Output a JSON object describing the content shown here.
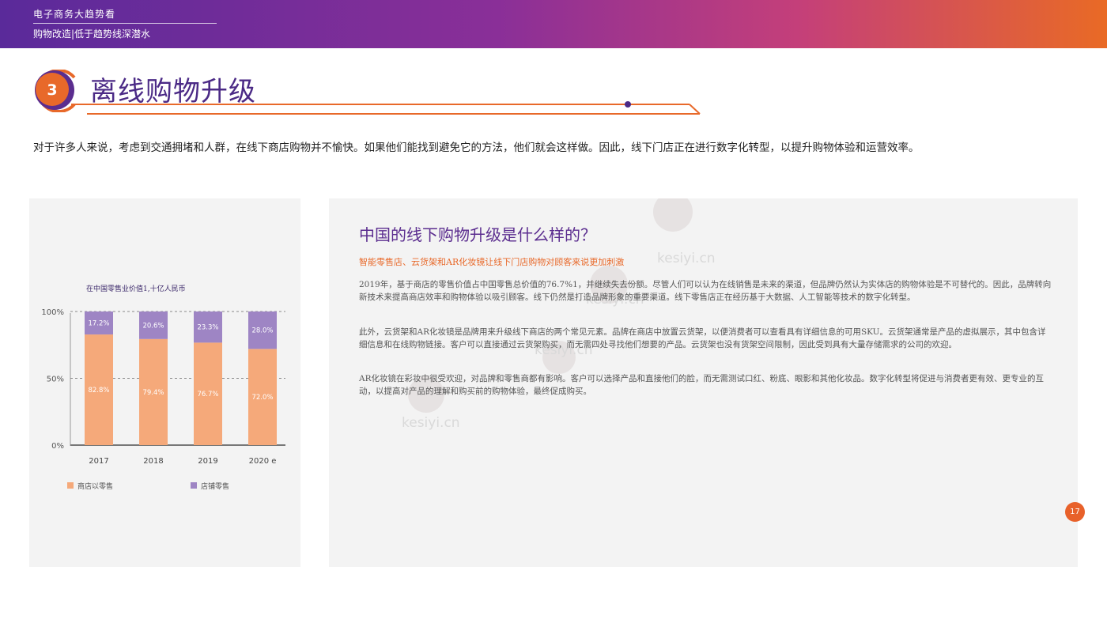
{
  "banner": {
    "title": "电子商务大趋势看",
    "subtitle": "购物改造|低于趋势线深潜水"
  },
  "section": {
    "number": "3",
    "title": "离线购物升级"
  },
  "intro_text": "对于许多人来说，考虑到交通拥堵和人群，在线下商店购物并不愉快。如果他们能找到避免它的方法，他们就会这样做。因此，线下门店正在进行数字化转型，以提升购物体验和运营效率。",
  "panel": {
    "heading": "中国的线下购物升级是什么样的？",
    "subheading": "智能零售店、云货架和AR化妆镜让线下门店购物对顾客来说更加刺激",
    "paragraphs": [
      "2019年，基于商店的零售价值占中国零售总价值的76.7%1，并继续失去份额。尽管人们可以认为在线销售是未来的渠道，但品牌仍然认为实体店的购物体验是不可替代的。因此，品牌转向新技术来提高商店效率和购物体验以吸引顾客。线下仍然是打造品牌形象的重要渠道。线下零售店正在经历基于大数据、人工智能等技术的数字化转型。",
      "此外，云货架和AR化妆镜是品牌用来升级线下商店的两个常见元素。品牌在商店中放置云货架，以便消费者可以查看具有详细信息的可用SKU。云货架通常是产品的虚拟展示，其中包含详细信息和在线购物链接。客户可以直接通过云货架购买，而无需四处寻找他们想要的产品。云货架也没有货架空间限制，因此受到具有大量存储需求的公司的欢迎。",
      "AR化妆镜在彩妆中很受欢迎，对品牌和零售商都有影响。客户可以选择产品和直接他们的脸，而无需测试口红、粉底、眼影和其他化妆品。数字化转型将促进与消费者更有效、更专业的互动，以提高对产品的理解和购买前的购物体验，最终促成购买。"
    ]
  },
  "watermark": "kesiyi.cn",
  "page_number": "17",
  "colors": {
    "brand_purple": "#5b2d8f",
    "brand_orange": "#e8692a",
    "store_series": "#f5a97a",
    "online_series": "#9e85c4"
  },
  "chart_data": {
    "type": "bar",
    "stacked": true,
    "percent": true,
    "title": "在中国零售业价值1,十亿人民币",
    "categories": [
      "2017",
      "2018",
      "2019",
      "2020 e"
    ],
    "series": [
      {
        "name": "商店以零售",
        "values": [
          82.8,
          79.4,
          76.7,
          72.0
        ],
        "labels": [
          "82.8%",
          "79.4%",
          "76.7%",
          "72.0%"
        ],
        "color": "#f5a97a"
      },
      {
        "name": "店铺零售",
        "values": [
          17.2,
          20.6,
          23.3,
          28.0
        ],
        "labels": [
          "17.2%",
          "20.6%",
          "23.3%",
          "28.0%"
        ],
        "color": "#9e85c4"
      }
    ],
    "yticks": [
      "0%",
      "50%",
      "100%"
    ],
    "ylim": [
      0,
      100
    ],
    "grid": "dashed at 50% and 100%",
    "legend": "bottom"
  }
}
